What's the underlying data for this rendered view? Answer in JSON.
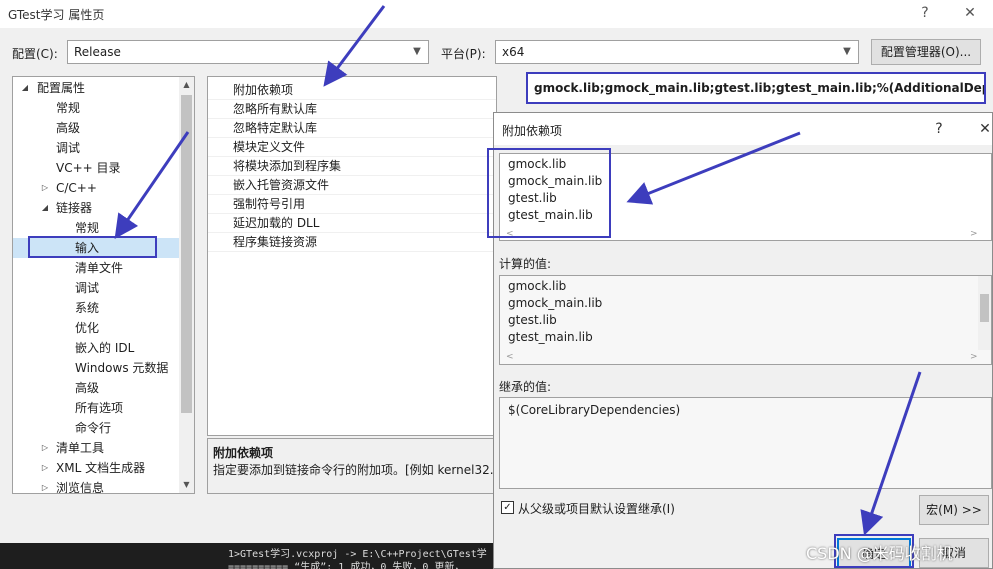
{
  "window": {
    "title": "GTest学习 属性页",
    "help": "?",
    "close": "✕"
  },
  "config": {
    "config_label": "配置(C):",
    "config_value": "Release",
    "platform_label": "平台(P):",
    "platform_value": "x64",
    "manager_button": "配置管理器(O)..."
  },
  "tree": {
    "items": [
      {
        "label": "配置属性",
        "toggle": "◢"
      },
      {
        "label": "常规",
        "toggle": ""
      },
      {
        "label": "高级",
        "toggle": ""
      },
      {
        "label": "调试",
        "toggle": ""
      },
      {
        "label": "VC++ 目录",
        "toggle": ""
      },
      {
        "label": "C/C++",
        "toggle": "▷"
      },
      {
        "label": "链接器",
        "toggle": "◢"
      },
      {
        "label": "常规",
        "toggle": ""
      },
      {
        "label": "输入",
        "toggle": ""
      },
      {
        "label": "清单文件",
        "toggle": ""
      },
      {
        "label": "调试",
        "toggle": ""
      },
      {
        "label": "系统",
        "toggle": ""
      },
      {
        "label": "优化",
        "toggle": ""
      },
      {
        "label": "嵌入的 IDL",
        "toggle": ""
      },
      {
        "label": "Windows 元数据",
        "toggle": ""
      },
      {
        "label": "高级",
        "toggle": ""
      },
      {
        "label": "所有选项",
        "toggle": ""
      },
      {
        "label": "命令行",
        "toggle": ""
      },
      {
        "label": "清单工具",
        "toggle": "▷"
      },
      {
        "label": "XML 文档生成器",
        "toggle": "▷"
      },
      {
        "label": "浏览信息",
        "toggle": "▷"
      }
    ]
  },
  "grid": {
    "rows": [
      "附加依赖项",
      "忽略所有默认库",
      "忽略特定默认库",
      "模块定义文件",
      "将模块添加到程序集",
      "嵌入托管资源文件",
      "强制符号引用",
      "延迟加载的 DLL",
      "程序集链接资源"
    ],
    "value": "gmock.lib;gmock_main.lib;gtest.lib;gtest_main.lib;%(AdditionalDependen"
  },
  "description": {
    "heading": "附加依赖项",
    "text": "指定要添加到链接命令行的附加项。[例如 kernel32.l"
  },
  "output": {
    "line1": "1>GTest学习.vcxproj -> E:\\C++Project\\GTest学",
    "line2": "========== “生成”: 1 成功，0 失败，0 更新，"
  },
  "popup": {
    "title": "附加依赖项",
    "help": "?",
    "close": "✕",
    "edit_lines": [
      "gmock.lib",
      "gmock_main.lib",
      "gtest.lib",
      "gtest_main.lib"
    ],
    "computed_label": "计算的值:",
    "computed_lines": [
      "gmock.lib",
      "gmock_main.lib",
      "gtest.lib",
      "gtest_main.lib"
    ],
    "inherited_label": "继承的值:",
    "inherited_value": "$(CoreLibraryDependencies)",
    "inherit_checkbox": "从父级或项目默认设置继承(I)",
    "inherit_checked": "✓",
    "macro_button": "宏(M) >>",
    "ok_button": "确定",
    "cancel_button": "取消"
  },
  "watermark": "CSDN @米码收割机",
  "colors": {
    "highlight": "#3d3dbd",
    "selection": "#cce4f7"
  }
}
